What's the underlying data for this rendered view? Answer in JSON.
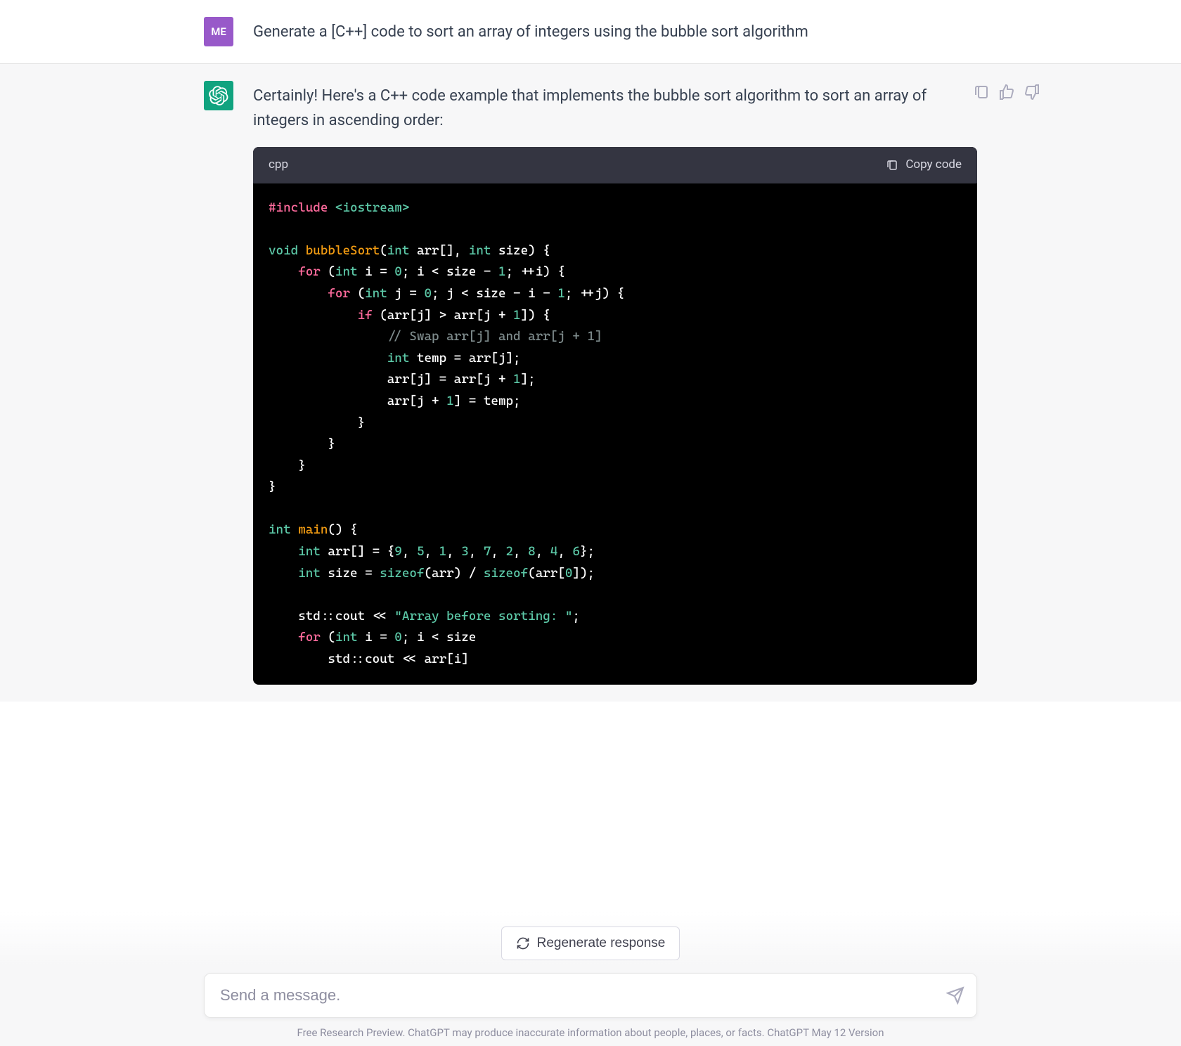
{
  "user": {
    "avatar_label": "ME",
    "message": "Generate a [C++] code to sort an array of integers using the bubble sort algorithm"
  },
  "assistant": {
    "intro": "Certainly! Here's a C++ code example that implements the bubble sort algorithm to sort an array of integers in ascending order:",
    "code": {
      "language": "cpp",
      "copy_label": "Copy code",
      "tokens": [
        [
          {
            "t": "#include ",
            "c": "tok-include"
          },
          {
            "t": "<iostream>",
            "c": "tok-header"
          }
        ],
        [],
        [
          {
            "t": "void",
            "c": "tok-type"
          },
          {
            "t": " "
          },
          {
            "t": "bubbleSort",
            "c": "tok-func"
          },
          {
            "t": "("
          },
          {
            "t": "int",
            "c": "tok-type"
          },
          {
            "t": " arr[], "
          },
          {
            "t": "int",
            "c": "tok-type"
          },
          {
            "t": " size) {"
          }
        ],
        [
          {
            "t": "    "
          },
          {
            "t": "for",
            "c": "tok-keyword"
          },
          {
            "t": " ("
          },
          {
            "t": "int",
            "c": "tok-type"
          },
          {
            "t": " i = "
          },
          {
            "t": "0",
            "c": "tok-num"
          },
          {
            "t": "; i < size - "
          },
          {
            "t": "1",
            "c": "tok-num"
          },
          {
            "t": "; ++i) {"
          }
        ],
        [
          {
            "t": "        "
          },
          {
            "t": "for",
            "c": "tok-keyword"
          },
          {
            "t": " ("
          },
          {
            "t": "int",
            "c": "tok-type"
          },
          {
            "t": " j = "
          },
          {
            "t": "0",
            "c": "tok-num"
          },
          {
            "t": "; j < size - i - "
          },
          {
            "t": "1",
            "c": "tok-num"
          },
          {
            "t": "; ++j) {"
          }
        ],
        [
          {
            "t": "            "
          },
          {
            "t": "if",
            "c": "tok-keyword"
          },
          {
            "t": " (arr[j] > arr[j + "
          },
          {
            "t": "1",
            "c": "tok-num"
          },
          {
            "t": "]) {"
          }
        ],
        [
          {
            "t": "                "
          },
          {
            "t": "// Swap arr[j] and arr[j + 1]",
            "c": "tok-comment"
          }
        ],
        [
          {
            "t": "                "
          },
          {
            "t": "int",
            "c": "tok-type"
          },
          {
            "t": " temp = arr[j];"
          }
        ],
        [
          {
            "t": "                arr[j] = arr[j + "
          },
          {
            "t": "1",
            "c": "tok-num"
          },
          {
            "t": "];"
          }
        ],
        [
          {
            "t": "                arr[j + "
          },
          {
            "t": "1",
            "c": "tok-num"
          },
          {
            "t": "] = temp;"
          }
        ],
        [
          {
            "t": "            }"
          }
        ],
        [
          {
            "t": "        }"
          }
        ],
        [
          {
            "t": "    }"
          }
        ],
        [
          {
            "t": "}"
          }
        ],
        [],
        [
          {
            "t": "int",
            "c": "tok-type"
          },
          {
            "t": " "
          },
          {
            "t": "main",
            "c": "tok-func"
          },
          {
            "t": "() {"
          }
        ],
        [
          {
            "t": "    "
          },
          {
            "t": "int",
            "c": "tok-type"
          },
          {
            "t": " arr[] = {"
          },
          {
            "t": "9",
            "c": "tok-num"
          },
          {
            "t": ", "
          },
          {
            "t": "5",
            "c": "tok-num"
          },
          {
            "t": ", "
          },
          {
            "t": "1",
            "c": "tok-num"
          },
          {
            "t": ", "
          },
          {
            "t": "3",
            "c": "tok-num"
          },
          {
            "t": ", "
          },
          {
            "t": "7",
            "c": "tok-num"
          },
          {
            "t": ", "
          },
          {
            "t": "2",
            "c": "tok-num"
          },
          {
            "t": ", "
          },
          {
            "t": "8",
            "c": "tok-num"
          },
          {
            "t": ", "
          },
          {
            "t": "4",
            "c": "tok-num"
          },
          {
            "t": ", "
          },
          {
            "t": "6",
            "c": "tok-num"
          },
          {
            "t": "};"
          }
        ],
        [
          {
            "t": "    "
          },
          {
            "t": "int",
            "c": "tok-type"
          },
          {
            "t": " size = "
          },
          {
            "t": "sizeof",
            "c": "tok-builtin"
          },
          {
            "t": "(arr) / "
          },
          {
            "t": "sizeof",
            "c": "tok-builtin"
          },
          {
            "t": "(arr["
          },
          {
            "t": "0",
            "c": "tok-num"
          },
          {
            "t": "]);"
          }
        ],
        [],
        [
          {
            "t": "    std::cout << "
          },
          {
            "t": "\"Array before sorting: \"",
            "c": "tok-string"
          },
          {
            "t": ";"
          }
        ],
        [
          {
            "t": "    "
          },
          {
            "t": "for",
            "c": "tok-keyword"
          },
          {
            "t": " ("
          },
          {
            "t": "int",
            "c": "tok-type"
          },
          {
            "t": " i = "
          },
          {
            "t": "0",
            "c": "tok-num"
          },
          {
            "t": "; i < size"
          }
        ],
        [
          {
            "t": "        std::cout << arr[i]"
          }
        ]
      ]
    }
  },
  "regenerate_label": "Regenerate response",
  "input_placeholder": "Send a message.",
  "footer": "Free Research Preview. ChatGPT may produce inaccurate information about people, places, or facts. ChatGPT May 12 Version"
}
